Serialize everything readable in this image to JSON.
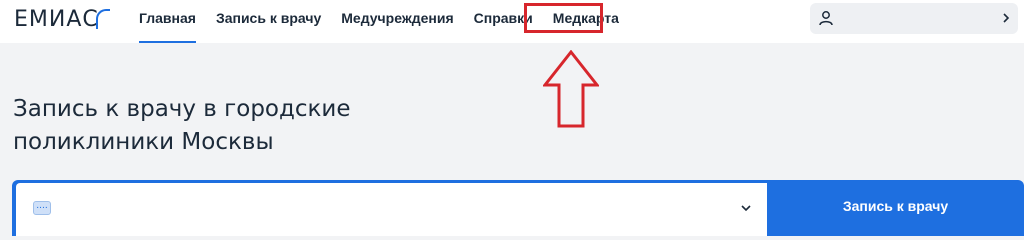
{
  "header": {
    "logo_text": "ЕМИАС",
    "nav": [
      {
        "label": "Главная"
      },
      {
        "label": "Запись к врачу"
      },
      {
        "label": "Медучреждения"
      },
      {
        "label": "Справки"
      },
      {
        "label": "Медкарта"
      }
    ],
    "active_nav": "Главная",
    "highlighted_nav": "Медкарта",
    "user": {
      "icon": "user-icon",
      "chevron": "chevron-right-icon"
    }
  },
  "main": {
    "title_line1": "Запись к врачу в городские",
    "title_line2": "поликлиники Москвы",
    "search": {
      "icon": "policy-card-icon",
      "value": "",
      "button_label": "Запись к врачу"
    }
  },
  "colors": {
    "accent": "#1e6fe0",
    "highlight": "#d7262c",
    "background": "#f2f3f5",
    "text": "#1c2a3a"
  }
}
